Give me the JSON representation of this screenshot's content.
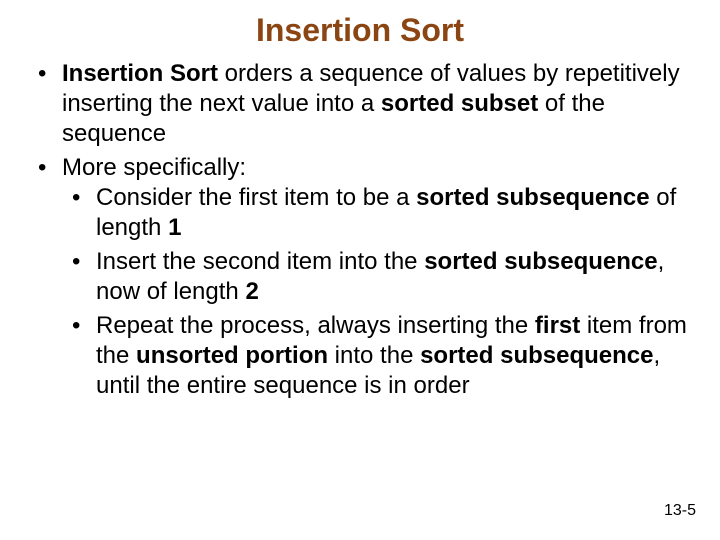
{
  "title": "Insertion Sort",
  "bullets": {
    "b1": {
      "t0": "Insertion Sort",
      "t1": " orders a sequence of values by repetitively inserting the next value into a ",
      "t2": "sorted subset",
      "t3": " of the sequence"
    },
    "b2": {
      "t0": "More specifically:",
      "sub": {
        "s1": {
          "t0": "Consider the first item to be a ",
          "t1": "sorted subsequence",
          "t2": " of length ",
          "t3": "1"
        },
        "s2": {
          "t0": "Insert the second item into the ",
          "t1": "sorted subsequence",
          "t2": ", now of length ",
          "t3": "2"
        },
        "s3": {
          "t0": "Repeat the process, always inserting the ",
          "t1": "first",
          "t2": " item from the ",
          "t3": "unsorted portion",
          "t4": " into the ",
          "t5": "sorted subsequence",
          "t6": ", until the entire sequence is in order"
        }
      }
    }
  },
  "footer": "13-5"
}
